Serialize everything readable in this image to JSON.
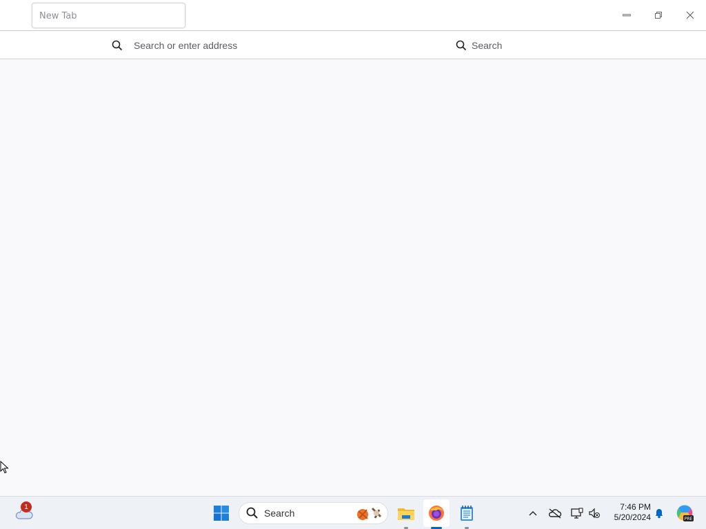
{
  "browser": {
    "tab": {
      "title": "New Tab"
    },
    "window_controls": {
      "minimize": "minimize-icon",
      "restore": "restore-icon",
      "close": "close-icon"
    },
    "urlbar": {
      "placeholder": "Search or enter address"
    },
    "searchbar": {
      "placeholder": "Search"
    }
  },
  "taskbar": {
    "weather": {
      "icon": "cloud-icon",
      "badge": "1"
    },
    "start": {
      "icon": "windows-start-icon"
    },
    "search": {
      "label": "Search"
    },
    "apps": [
      {
        "name": "File Explorer",
        "icon": "folder-icon",
        "running": true,
        "active": false
      },
      {
        "name": "Firefox",
        "icon": "firefox-icon",
        "running": true,
        "active": true
      },
      {
        "name": "Notepad",
        "icon": "notepad-icon",
        "running": true,
        "active": false
      }
    ],
    "tray": {
      "time": "7:46 PM",
      "date": "5/20/2024",
      "icons": [
        "chevron-up-icon",
        "cloud-offline-icon",
        "display-icon",
        "network-volume-icon",
        "bell-icon",
        "copilot-icon"
      ]
    }
  },
  "colors": {
    "accent": "#0067c0",
    "badge": "#c42b1c",
    "content_bg": "#f9f9fb"
  }
}
